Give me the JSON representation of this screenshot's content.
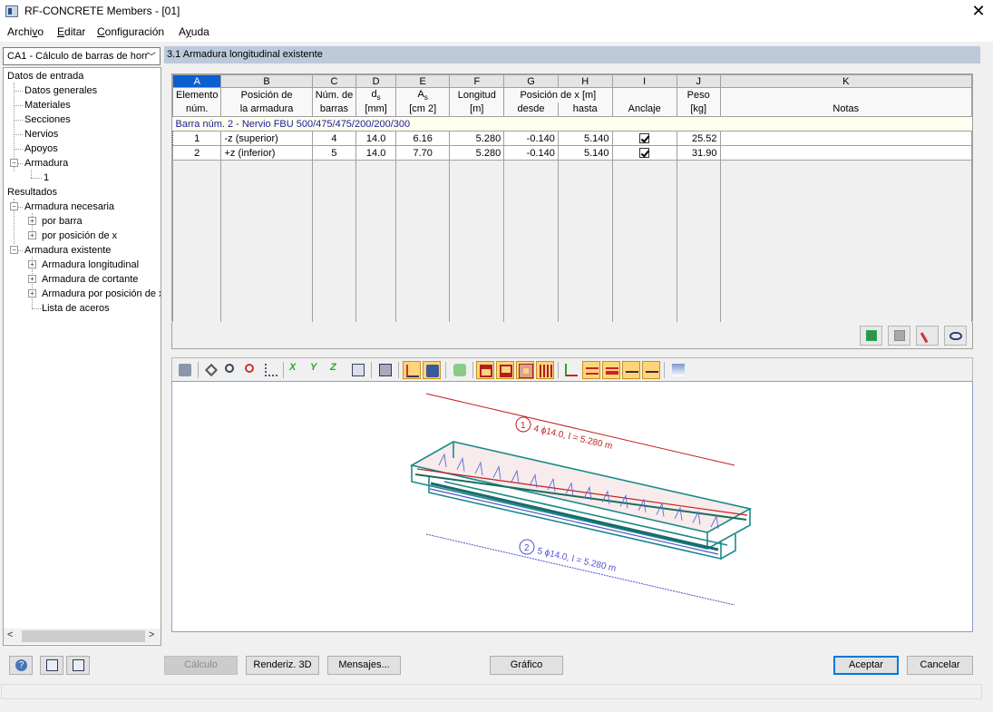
{
  "window": {
    "title": "RF-CONCRETE Members - [01]"
  },
  "menu": [
    {
      "label": "Archivo",
      "u": "v",
      "pre": "Archi",
      "post": "o"
    },
    {
      "label": "Editar",
      "u": "E",
      "pre": "",
      "post": "ditar"
    },
    {
      "label": "Configuración",
      "u": "C",
      "pre": "",
      "post": "onfiguración"
    },
    {
      "label": "Ayuda",
      "u": "y",
      "pre": "A",
      "post": "uda"
    }
  ],
  "sidebar": {
    "case_select": "CA1 - Cálculo de barras de horr",
    "tree": {
      "input_root": "Datos de entrada",
      "general": "Datos generales",
      "materials": "Materiales",
      "sections": "Secciones",
      "ribs": "Nervios",
      "supports": "Apoyos",
      "reinforcement": "Armadura",
      "reinforcement_1": "1",
      "results_root": "Resultados",
      "required": "Armadura necesaria",
      "by_member": "por barra",
      "by_x": "por posición de x",
      "existing": "Armadura existente",
      "longitudinal": "Armadura longitudinal",
      "shear": "Armadura de cortante",
      "by_x_pos": "Armadura por posición de x",
      "steel_list": "Lista de aceros"
    }
  },
  "panel": {
    "header": "3.1 Armadura longitudinal existente"
  },
  "table": {
    "col_letters": [
      "A",
      "B",
      "C",
      "D",
      "E",
      "F",
      "G",
      "H",
      "I",
      "J",
      "K"
    ],
    "header1": [
      "Elemento",
      "Posición de",
      "Núm. de",
      "d",
      "A",
      "Longitud",
      "Posición de x [m]",
      "",
      "",
      "Peso",
      ""
    ],
    "header1_sub": {
      "d": "s",
      "A": "s"
    },
    "header2": [
      "núm.",
      "la armadura",
      "barras",
      "[mm]",
      "[cm 2]",
      "[m]",
      "desde",
      "hasta",
      "Anclaje",
      "[kg]",
      "Notas"
    ],
    "group_label": "Barra núm. 2  -  Nervio FBU 500/475/475/200/200/300",
    "rows": [
      {
        "elem": "1",
        "pos": "-z (superior)",
        "bars": "4",
        "ds": "14.0",
        "as": "6.16",
        "len": "5.280",
        "from": "-0.140",
        "to": "5.140",
        "anchor": true,
        "weight": "25.52",
        "notes": ""
      },
      {
        "elem": "2",
        "pos": "+z (inferior)",
        "bars": "5",
        "ds": "14.0",
        "as": "7.70",
        "len": "5.280",
        "from": "-0.140",
        "to": "5.140",
        "anchor": true,
        "weight": "31.90",
        "notes": ""
      }
    ]
  },
  "graphic": {
    "label_top_num": "1",
    "label_top": "4 ϕ14.0, l = 5.280 m",
    "label_bottom_num": "2",
    "label_bottom": "5 ϕ14.0, l = 5.280 m"
  },
  "buttons": {
    "calc": "Cálculo",
    "render": "Renderiz. 3D",
    "messages": "Mensajes...",
    "graphic": "Gráfico",
    "ok": "Aceptar",
    "cancel": "Cancelar"
  },
  "colors": {
    "accent": "#0b5fd1",
    "header_bar": "#bcc9d9",
    "beam": "#1a8a8a",
    "top_rebar": "#c41e1e",
    "bottom_rebar": "#5050d0"
  }
}
